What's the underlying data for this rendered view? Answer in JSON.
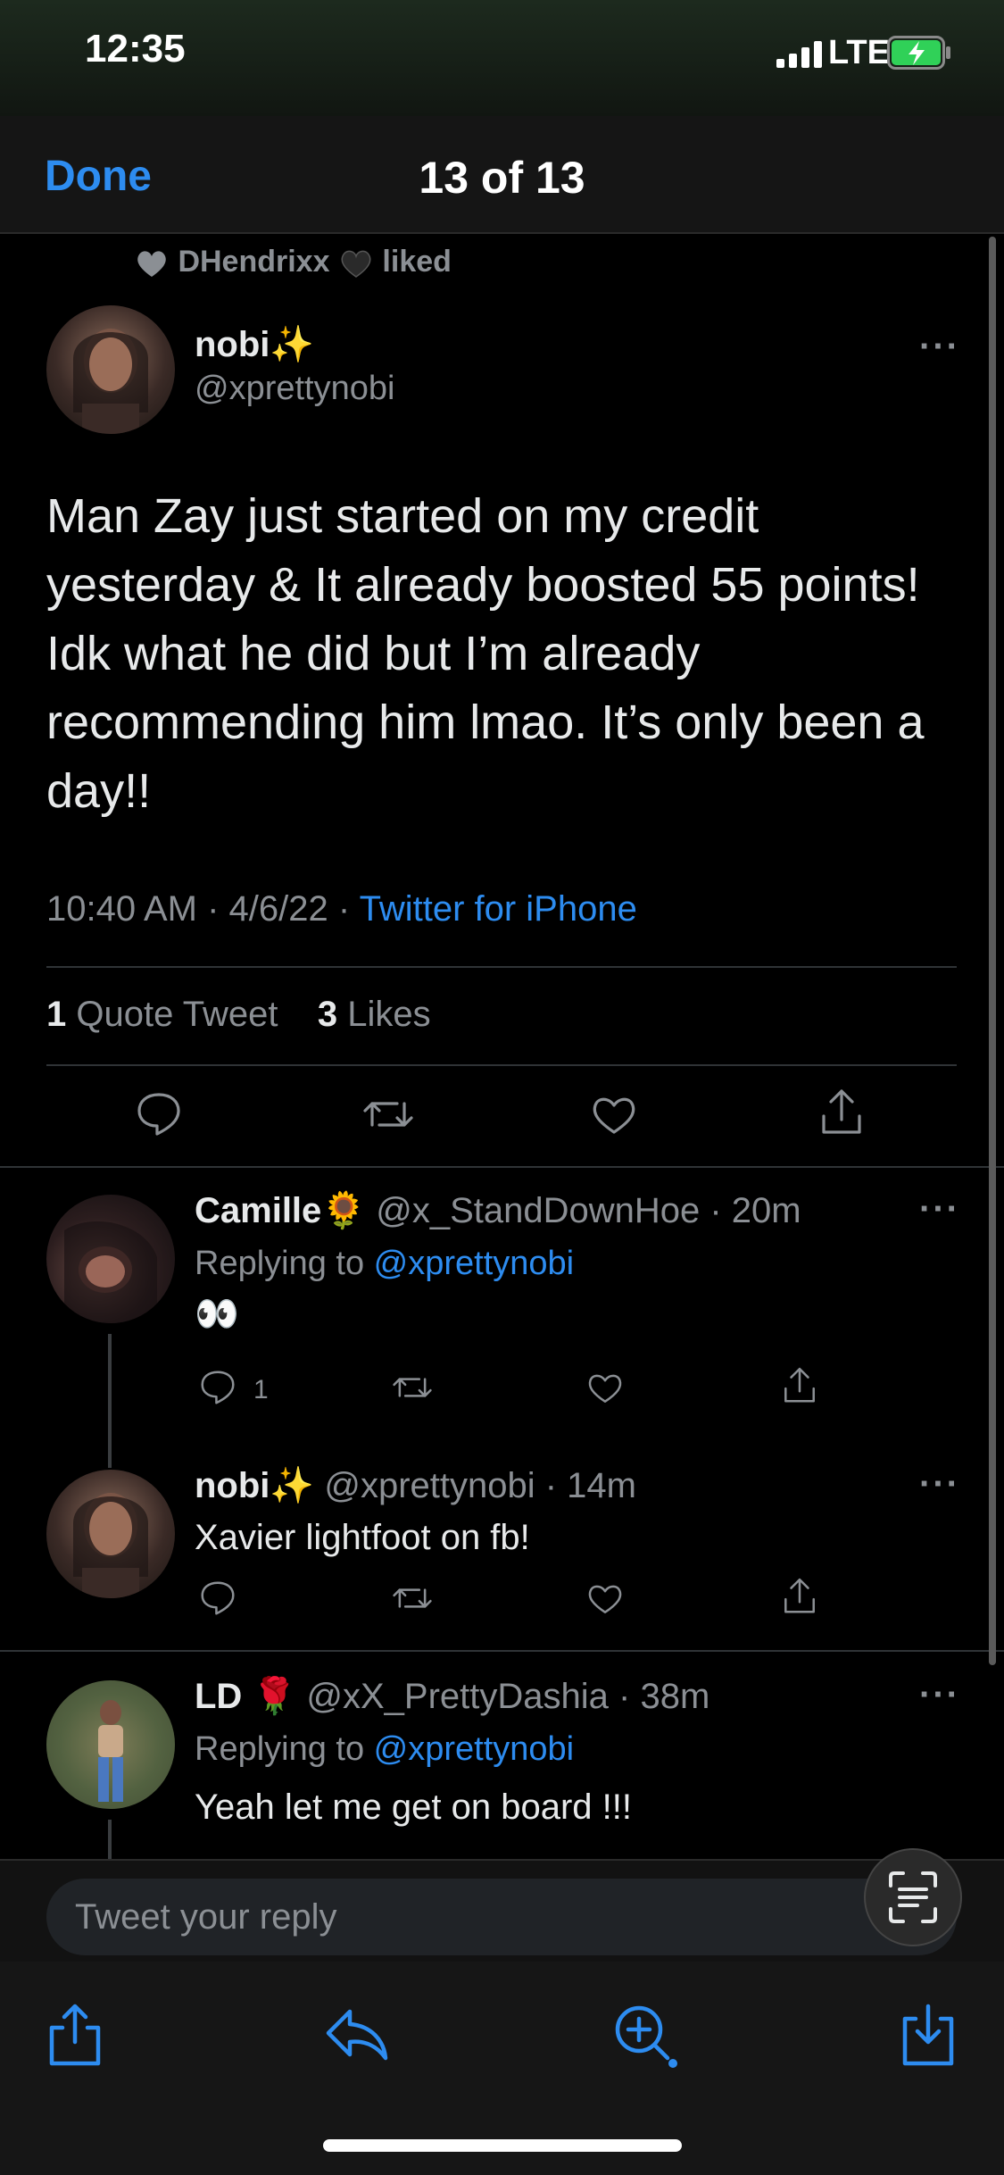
{
  "status": {
    "time": "12:35",
    "network": "LTE",
    "signal_icon": "signal-bars-icon",
    "battery_icon": "battery-charging-icon",
    "battery_color": "#30d158"
  },
  "nav": {
    "done_label": "Done",
    "counter": "13 of 13"
  },
  "main_tweet": {
    "liked_by": "DHendrixx",
    "liked_label": "liked",
    "name": "nobi",
    "name_emoji": "✨",
    "handle": "@xprettynobi",
    "text": "Man Zay just started on my credit yesterday & It already boosted 55 points! Idk what he did but I’m already recommending him lmao. It’s only been a day!!",
    "time_date": "10:40 AM · 4/6/22 · ",
    "source": "Twitter for iPhone",
    "quote_count": "1",
    "quote_label": "Quote Tweet",
    "likes_count": "3",
    "likes_label": "Likes",
    "more": "···"
  },
  "replies": [
    {
      "name": "Camille",
      "name_emoji": "🌻",
      "handle_time": "@x_StandDownHoe · 20m",
      "replying_label": "Replying to ",
      "replying_to": "@xprettynobi",
      "text": "👀",
      "reply_count": "1",
      "more": "···"
    },
    {
      "name": "nobi",
      "name_emoji": "✨",
      "handle_time": "@xprettynobi · 14m",
      "text": "Xavier lightfoot on fb!",
      "more": "···"
    },
    {
      "name": "LD",
      "name_emoji": "🌹",
      "handle_time": "@xX_PrettyDashia · 38m",
      "replying_label": "Replying to ",
      "replying_to": "@xprettynobi",
      "text": "Yeah let me get on board !!!",
      "more": "···"
    }
  ],
  "reply_box": {
    "placeholder": "Tweet your reply"
  },
  "toolbar": {
    "icons": [
      "share-icon",
      "reply-icon",
      "zoom-in-icon",
      "download-icon"
    ],
    "accent": "#2d8cf0"
  }
}
